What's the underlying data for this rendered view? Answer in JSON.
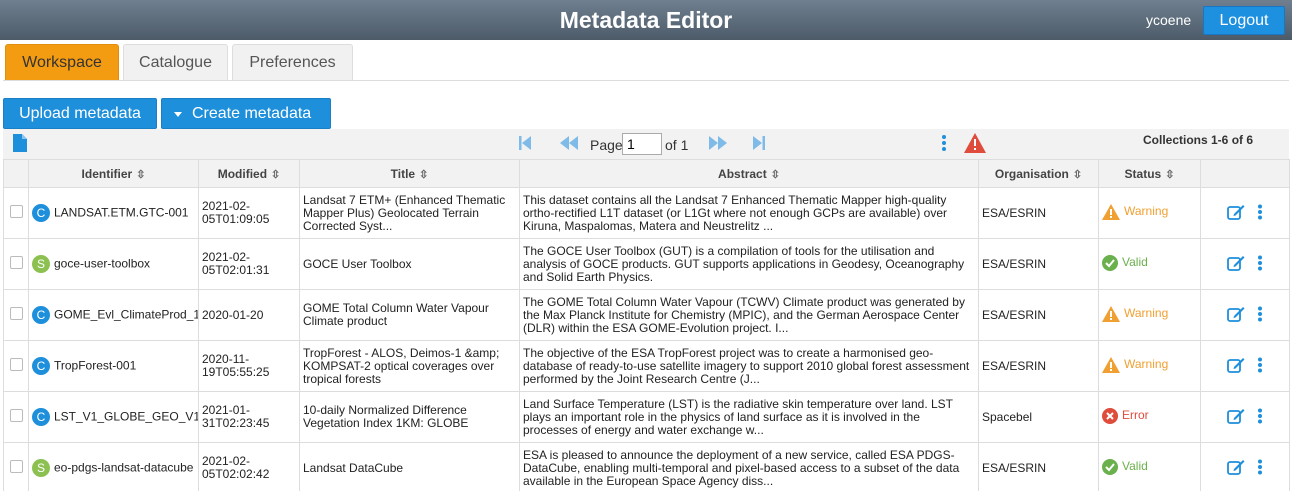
{
  "header": {
    "title": "Metadata Editor",
    "username": "ycoene",
    "logout_label": "Logout"
  },
  "tabs": [
    {
      "label": "Workspace",
      "active": true
    },
    {
      "label": "Catalogue",
      "active": false
    },
    {
      "label": "Preferences",
      "active": false
    }
  ],
  "toolbar": {
    "upload_label": "Upload metadata",
    "create_label": "Create metadata"
  },
  "pager": {
    "page_label": "Page",
    "page_value": "1",
    "of_label": "of 1",
    "collections_label": "Collections 1-6 of 6"
  },
  "columns": [
    "Identifier",
    "Modified",
    "Title",
    "Abstract",
    "Organisation",
    "Status"
  ],
  "rows": [
    {
      "type": "C",
      "identifier": "LANDSAT.ETM.GTC-001",
      "modified": "2021-02-05T01:09:05",
      "title": "Landsat 7 ETM+ (Enhanced Thematic Mapper Plus) Geolocated Terrain Corrected Syst...",
      "abstract": "This dataset contains all the Landsat 7 Enhanced Thematic Mapper high-quality ortho-rectified L1T dataset (or L1Gt where not enough GCPs are available) over Kiruna, Maspalomas, Matera and Neustrelitz ...",
      "organisation": "ESA/ESRIN",
      "status": "Warning"
    },
    {
      "type": "S",
      "identifier": "goce-user-toolbox",
      "modified": "2021-02-05T02:01:31",
      "title": "GOCE User Toolbox",
      "abstract": "The GOCE User Toolbox (GUT) is a compilation of tools for the utilisation and analysis of GOCE products. GUT supports applications in Geodesy, Oceanography and Solid Earth Physics.",
      "organisation": "ESA/ESRIN",
      "status": "Valid"
    },
    {
      "type": "C",
      "identifier": "GOME_Evl_ClimateProd_1",
      "modified": "2020-01-20",
      "title": "GOME Total Column Water Vapour Climate product",
      "abstract": "The GOME Total Column Water Vapour (TCWV) Climate product was generated by the Max Planck Institute for Chemistry (MPIC), and the German Aerospace Center (DLR) within the ESA GOME-Evolution project. I...",
      "organisation": "ESA/ESRIN",
      "status": "Warning"
    },
    {
      "type": "C",
      "identifier": "TropForest-001",
      "modified": "2020-11-19T05:55:25",
      "title": "TropForest - ALOS, Deimos-1 &amp; KOMPSAT-2 optical coverages over tropical forests",
      "abstract": "The objective of the ESA TropForest project was to create a harmonised geo-database of ready-to-use satellite imagery to support 2010 global forest assessment performed by the Joint Research Centre (J...",
      "organisation": "ESA/ESRIN",
      "status": "Warning"
    },
    {
      "type": "C",
      "identifier": "LST_V1_GLOBE_GEO_V1",
      "modified": "2021-01-31T02:23:45",
      "title": "10-daily Normalized Difference Vegetation Index 1KM: GLOBE",
      "abstract": "Land Surface Temperature (LST) is the radiative skin temperature over land. LST plays an important role in the physics of land surface as it is involved in the processes of energy and water exchange w...",
      "organisation": "Spacebel",
      "status": "Error"
    },
    {
      "type": "S",
      "identifier": "eo-pdgs-landsat-datacube",
      "modified": "2021-02-05T02:02:42",
      "title": "Landsat DataCube",
      "abstract": "ESA is pleased to announce the deployment of a new service, called ESA PDGS-DataCube, enabling multi-temporal and pixel-based access to a subset of the data available in the European Space Agency diss...",
      "organisation": "ESA/ESRIN",
      "status": "Valid"
    }
  ],
  "colors": {
    "accent": "#1e8fdb",
    "active_tab": "#f39c12",
    "warning": "#f0a030",
    "valid": "#6ab04c",
    "error": "#e04c3c"
  }
}
